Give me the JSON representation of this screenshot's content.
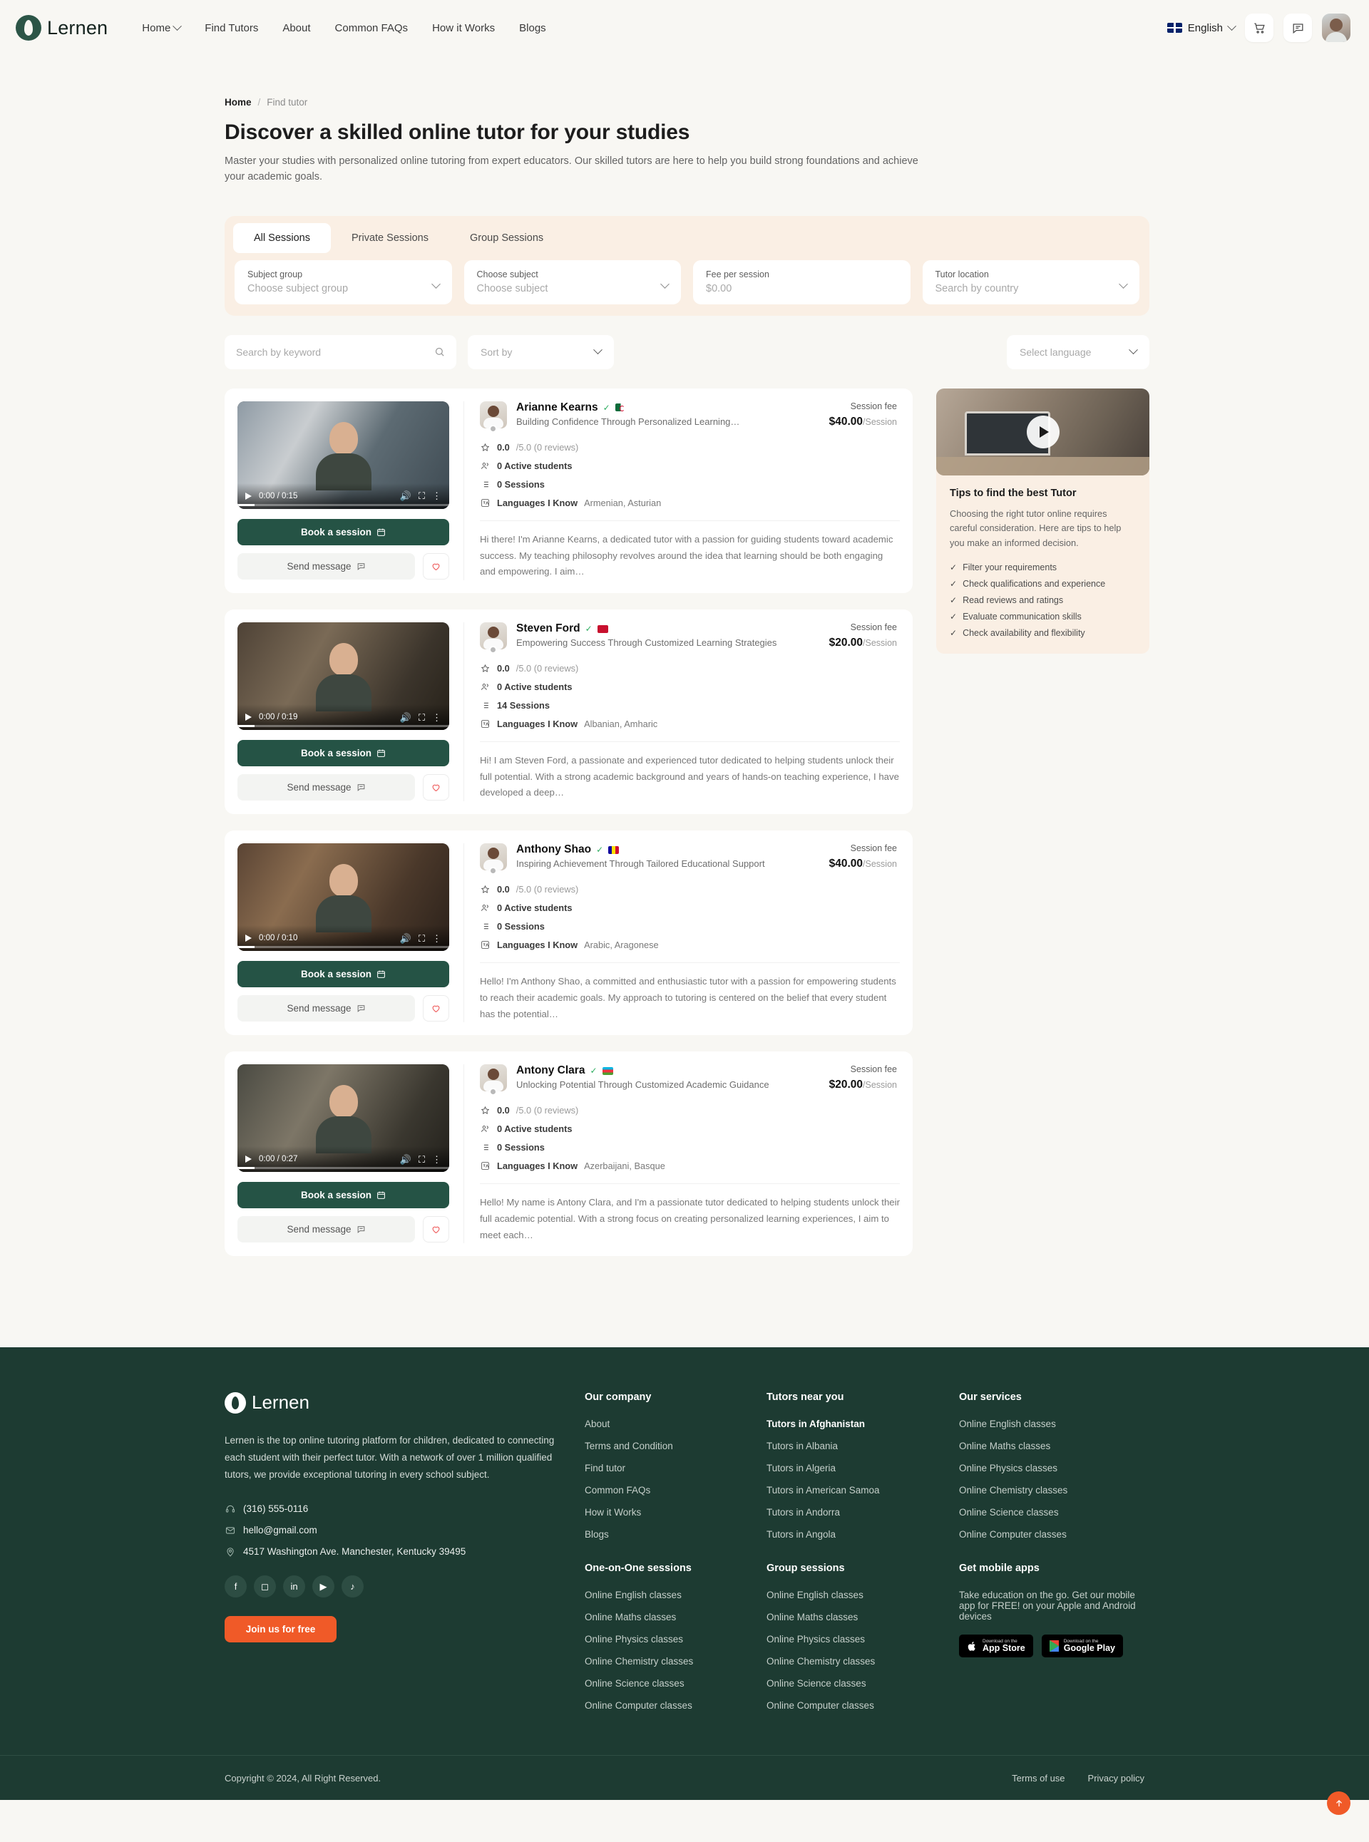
{
  "header": {
    "brand": "Lernen",
    "nav": [
      {
        "label": "Home",
        "caret": true
      },
      {
        "label": "Find Tutors",
        "caret": false
      },
      {
        "label": "About",
        "caret": false
      },
      {
        "label": "Common FAQs",
        "caret": false
      },
      {
        "label": "How it Works",
        "caret": false
      },
      {
        "label": "Blogs",
        "caret": false
      }
    ],
    "language": "English",
    "cart_icon": "cart-icon",
    "chat_icon": "chat-icon",
    "avatar": "user-avatar"
  },
  "breadcrumb": {
    "home": "Home",
    "sep": "/",
    "current": "Find tutor"
  },
  "hero": {
    "title": "Discover a skilled online tutor for your studies",
    "subtitle": "Master your studies with personalized online tutoring from expert educators. Our skilled tutors are here to help you build strong foundations and achieve your academic goals."
  },
  "tabs": [
    {
      "label": "All Sessions",
      "active": true
    },
    {
      "label": "Private Sessions",
      "active": false
    },
    {
      "label": "Group Sessions",
      "active": false
    }
  ],
  "filters": [
    {
      "label": "Subject group",
      "value": "Choose subject group",
      "chevron": true
    },
    {
      "label": "Choose subject",
      "value": "Choose subject",
      "chevron": true
    },
    {
      "label": "Fee per session",
      "value": "$0.00",
      "chevron": false
    },
    {
      "label": "Tutor location",
      "value": "Search by country",
      "chevron": true
    }
  ],
  "search": {
    "placeholder": "Search by keyword",
    "value": "",
    "sort_by": "Sort by",
    "select_language": "Select language"
  },
  "tutors": [
    {
      "name": "Arianne Kearns",
      "tagline": "Building Confidence Through Personalized Learning…",
      "flag": "f-dz",
      "fee_label": "Session fee",
      "fee_amount": "$40.00",
      "fee_unit": "/Session",
      "rating": "0.0/5.0 (0 reviews)",
      "rating_value": "0.0",
      "rating_max": "/5.0 (0 reviews)",
      "active_students": "0 Active students",
      "sessions": "0 Sessions",
      "languages_label": "Languages I Know",
      "languages": "Armenian, Asturian",
      "bio": "Hi there! I'm Arianne Kearns, a dedicated tutor with a passion for guiding students toward academic success. My teaching philosophy revolves around the idea that learning should be both engaging and empowering. I aim…",
      "video_time": "0:00 / 0:15",
      "book_label": "Book a session",
      "message_label": "Send message"
    },
    {
      "name": "Steven Ford",
      "tagline": "Empowering Success Through Customized Learning Strategies",
      "flag": "f-al",
      "fee_label": "Session fee",
      "fee_amount": "$20.00",
      "fee_unit": "/Session",
      "rating_value": "0.0",
      "rating_max": "/5.0 (0 reviews)",
      "active_students": "0 Active students",
      "sessions": "14 Sessions",
      "languages_label": "Languages I Know",
      "languages": "Albanian, Amharic",
      "bio": "Hi! I am Steven Ford, a passionate and experienced tutor dedicated to helping students unlock their full potential. With a strong academic background and years of hands-on teaching experience, I have developed a deep…",
      "video_time": "0:00 / 0:19",
      "book_label": "Book a session",
      "message_label": "Send message"
    },
    {
      "name": "Anthony Shao",
      "tagline": "Inspiring Achievement Through Tailored Educational Support",
      "flag": "f-ad",
      "fee_label": "Session fee",
      "fee_amount": "$40.00",
      "fee_unit": "/Session",
      "rating_value": "0.0",
      "rating_max": "/5.0 (0 reviews)",
      "active_students": "0 Active students",
      "sessions": "0 Sessions",
      "languages_label": "Languages I Know",
      "languages": "Arabic, Aragonese",
      "bio": "Hello! I'm Anthony Shao, a committed and enthusiastic tutor with a passion for empowering students to reach their academic goals. My approach to tutoring is centered on the belief that every student has the potential…",
      "video_time": "0:00 / 0:10",
      "book_label": "Book a session",
      "message_label": "Send message"
    },
    {
      "name": "Antony Clara",
      "tagline": "Unlocking Potential Through Customized Academic Guidance",
      "flag": "f-az",
      "fee_label": "Session fee",
      "fee_amount": "$20.00",
      "fee_unit": "/Session",
      "rating_value": "0.0",
      "rating_max": "/5.0 (0 reviews)",
      "active_students": "0 Active students",
      "sessions": "0 Sessions",
      "languages_label": "Languages I Know",
      "languages": "Azerbaijani, Basque",
      "bio": "Hello! My name is Antony Clara, and I'm a passionate tutor dedicated to helping students unlock their full academic potential. With a strong focus on creating personalized learning experiences, I aim to meet each…",
      "video_time": "0:00 / 0:27",
      "book_label": "Book a session",
      "message_label": "Send message"
    }
  ],
  "tips": {
    "title": "Tips to find the best Tutor",
    "body": "Choosing the right tutor online requires careful consideration. Here are tips to help you make an informed decision.",
    "items": [
      "Filter your requirements",
      "Check qualifications and experience",
      "Read reviews and ratings",
      "Evaluate communication skills",
      "Check availability and flexibility"
    ]
  },
  "footer": {
    "brand": "Lernen",
    "description": "Lernen is the top online tutoring platform for children, dedicated to connecting each student with their perfect tutor. With a network of over 1 million qualified tutors, we provide exceptional tutoring in every school subject.",
    "phone": "(316) 555-0116",
    "email": "hello@gmail.com",
    "address": "4517 Washington Ave. Manchester, Kentucky 39495",
    "socials": [
      "facebook-icon",
      "instagram-icon",
      "linkedin-icon",
      "youtube-icon",
      "tiktok-icon"
    ],
    "join_label": "Join us for free",
    "company": {
      "title": "Our company",
      "links": [
        "About",
        "Terms and Condition",
        "Find tutor",
        "Common FAQs",
        "How it Works",
        "Blogs"
      ]
    },
    "tutors_near": {
      "title": "Tutors near you",
      "links": [
        "Tutors in Afghanistan",
        "Tutors in Albania",
        "Tutors in Algeria",
        "Tutors in American Samoa",
        "Tutors in Andorra",
        "Tutors in Angola"
      ]
    },
    "services": {
      "title": "Our services",
      "links": [
        "Online English classes",
        "Online Maths classes",
        "Online Physics classes",
        "Online Chemistry classes",
        "Online Science classes",
        "Online Computer classes"
      ]
    },
    "one_on_one": {
      "title": "One-on-One sessions",
      "links": [
        "Online English classes",
        "Online Maths classes",
        "Online Physics classes",
        "Online Chemistry classes",
        "Online Science classes",
        "Online Computer classes"
      ]
    },
    "group": {
      "title": "Group sessions",
      "links": [
        "Online English classes",
        "Online Maths classes",
        "Online Physics classes",
        "Online Chemistry classes",
        "Online Science classes",
        "Online Computer classes"
      ]
    },
    "mobile": {
      "title": "Get mobile apps",
      "text": "Take education on the go. Get our mobile app for FREE! on your Apple and Android devices",
      "appstore_small": "Download on the",
      "appstore_big": "App Store",
      "google_small": "Download on the",
      "google_big": "Google Play"
    },
    "copyright": "Copyright © 2024, All Right Reserved.",
    "terms": "Terms of use",
    "privacy": "Privacy policy"
  },
  "colors": {
    "brand_green": "#1d3b32",
    "accent_orange": "#f05a28",
    "panel_cream": "#faefe4"
  }
}
